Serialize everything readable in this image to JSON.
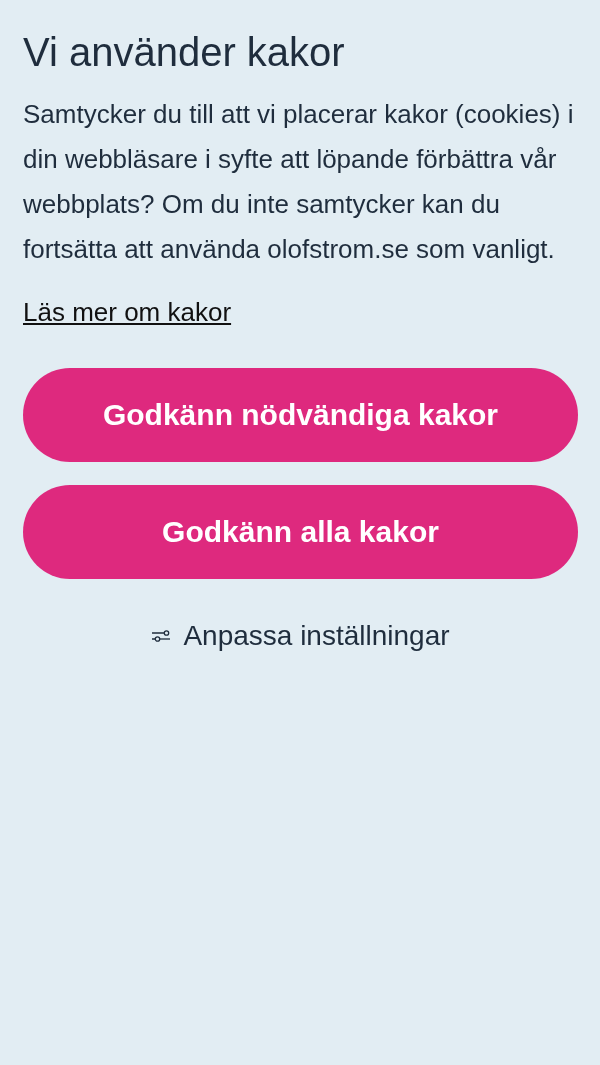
{
  "title": "Vi använder kakor",
  "body": "Samtycker du till att vi placerar kakor (cookies) i din webbläsare i syfte att löpande förbättra vår webbplats? Om du inte samtycker kan du fortsätta att använda olofstrom.se som vanligt.",
  "link": "Läs mer om kakor",
  "buttons": [
    "Godkänn nödvändiga kakor",
    "Godkänn alla kakor"
  ],
  "settings": "Anpassa inställningar"
}
